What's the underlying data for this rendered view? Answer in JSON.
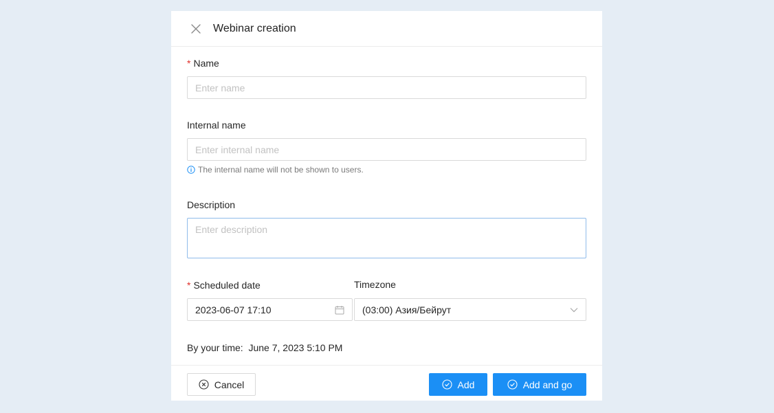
{
  "modal": {
    "title": "Webinar creation"
  },
  "fields": {
    "name": {
      "label": "Name",
      "required_mark": "*",
      "placeholder": "Enter name",
      "value": ""
    },
    "internal_name": {
      "label": "Internal name",
      "placeholder": "Enter internal name",
      "value": "",
      "hint": "The internal name will not be shown to users."
    },
    "description": {
      "label": "Description",
      "placeholder": "Enter description",
      "value": ""
    },
    "scheduled_date": {
      "label": "Scheduled date",
      "required_mark": "*",
      "value": "2023-06-07 17:10"
    },
    "timezone": {
      "label": "Timezone",
      "value": "(03:00) Азия/Бейрут"
    }
  },
  "by_your_time": {
    "label": "By your time:",
    "value": "June 7, 2023 5:10 PM"
  },
  "footer": {
    "cancel_label": "Cancel",
    "add_label": "Add",
    "add_and_go_label": "Add and go"
  },
  "icons": {
    "close": "close-icon",
    "info": "info-circle-icon",
    "calendar": "calendar-icon",
    "dropdown": "chevron-down-icon",
    "cancel": "close-circle-icon",
    "check": "check-circle-icon"
  },
  "colors": {
    "primary": "#1b8ff5",
    "required": "#e0302b",
    "background": "#e5edf5",
    "info": "#1b8ff5"
  }
}
